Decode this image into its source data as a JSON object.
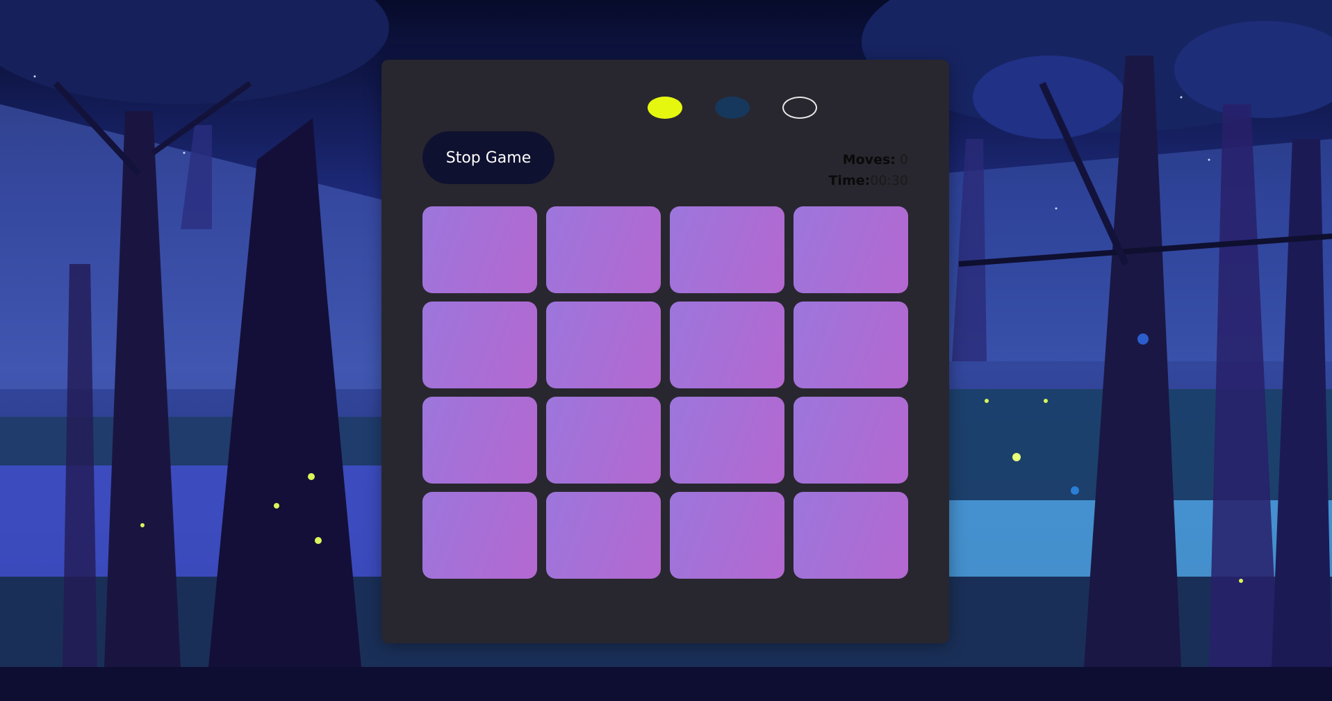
{
  "game": {
    "stop_button_label": "Stop Game",
    "moves_label": "Moves:",
    "moves_value": "0",
    "time_label": "Time:",
    "time_value": "00:30",
    "cards_count_rows": 4,
    "cards_count_cols": 4,
    "cards_state": "face-down"
  },
  "indicators": [
    {
      "name": "yellow-indicator",
      "color": "#e5f70f"
    },
    {
      "name": "teal-indicator",
      "color": "#16385c"
    },
    {
      "name": "outline-indicator",
      "color": "transparent"
    }
  ],
  "colors": {
    "panel": "#28272f",
    "card_start": "#9c76dc",
    "card_end": "#b468d0",
    "button_bg": "#0f1130",
    "footer": "#0e0e33"
  }
}
